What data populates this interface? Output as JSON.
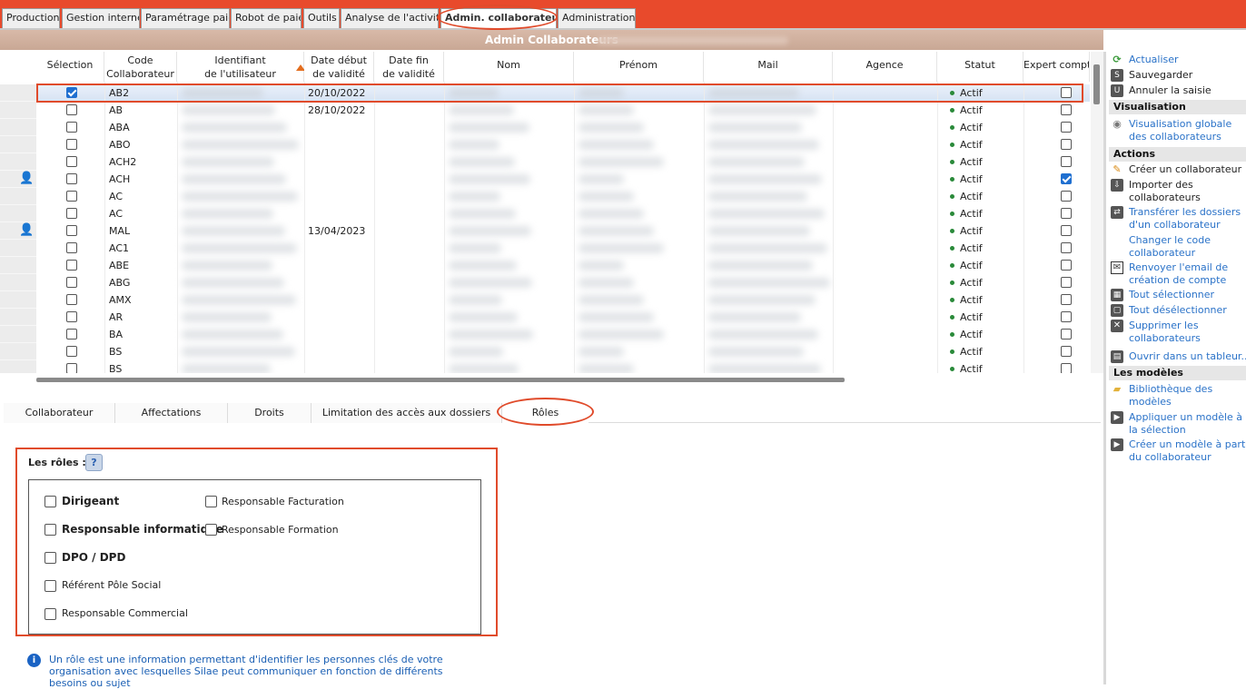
{
  "tabs": [
    "Production",
    "Gestion interne",
    "Paramétrage paie",
    "Robot de paie",
    "Outils",
    "Analyse de l'activité",
    "Admin. collaborateurs",
    "Administration"
  ],
  "page_title": "Admin Collaborateurs",
  "grid": {
    "headers": {
      "selection": "Sélection",
      "code_1": "Code",
      "code_2": "Collaborateur",
      "ident_1": "Identifiant",
      "ident_2": "de l'utilisateur",
      "debut_1": "Date début",
      "debut_2": "de validité",
      "fin_1": "Date fin",
      "fin_2": "de validité",
      "nom": "Nom",
      "prenom": "Prénom",
      "mail": "Mail",
      "agence": "Agence",
      "statut": "Statut",
      "expert": "Expert compt"
    },
    "rows": [
      {
        "code": "AB2",
        "debut": "20/10/2022",
        "statut": "Actif",
        "selected": true,
        "expert": false,
        "icon": false
      },
      {
        "code": "AB",
        "debut": "28/10/2022",
        "statut": "Actif",
        "selected": false,
        "expert": false,
        "icon": false
      },
      {
        "code": "ABA",
        "debut": "",
        "statut": "Actif",
        "selected": false,
        "expert": false,
        "icon": false
      },
      {
        "code": "ABO",
        "debut": "",
        "statut": "Actif",
        "selected": false,
        "expert": false,
        "icon": false
      },
      {
        "code": "ACH2",
        "debut": "",
        "statut": "Actif",
        "selected": false,
        "expert": false,
        "icon": false
      },
      {
        "code": "ACH",
        "debut": "",
        "statut": "Actif",
        "selected": false,
        "expert": true,
        "icon": true
      },
      {
        "code": "AC",
        "debut": "",
        "statut": "Actif",
        "selected": false,
        "expert": false,
        "icon": false
      },
      {
        "code": "AC",
        "debut": "",
        "statut": "Actif",
        "selected": false,
        "expert": false,
        "icon": false
      },
      {
        "code": "MAL",
        "debut": "13/04/2023",
        "statut": "Actif",
        "selected": false,
        "expert": false,
        "icon": true
      },
      {
        "code": "AC1",
        "debut": "",
        "statut": "Actif",
        "selected": false,
        "expert": false,
        "icon": false
      },
      {
        "code": "ABE",
        "debut": "",
        "statut": "Actif",
        "selected": false,
        "expert": false,
        "icon": false
      },
      {
        "code": "ABG",
        "debut": "",
        "statut": "Actif",
        "selected": false,
        "expert": false,
        "icon": false
      },
      {
        "code": "AMX",
        "debut": "",
        "statut": "Actif",
        "selected": false,
        "expert": false,
        "icon": false
      },
      {
        "code": "AR",
        "debut": "",
        "statut": "Actif",
        "selected": false,
        "expert": false,
        "icon": false
      },
      {
        "code": "BA",
        "debut": "",
        "statut": "Actif",
        "selected": false,
        "expert": false,
        "icon": false
      },
      {
        "code": "BS",
        "debut": "",
        "statut": "Actif",
        "selected": false,
        "expert": false,
        "icon": false
      },
      {
        "code": "BS",
        "debut": "",
        "statut": "Actif",
        "selected": false,
        "expert": false,
        "icon": false
      }
    ]
  },
  "subtabs": [
    "Collaborateur",
    "Affectations",
    "Droits",
    "Limitation des accès aux dossiers",
    "Rôles"
  ],
  "roles": {
    "label": "Les rôles :",
    "left": [
      {
        "label": "Dirigeant",
        "bold": true
      },
      {
        "label": "Responsable informatique",
        "bold": true
      },
      {
        "label": "DPO / DPD",
        "bold": true
      },
      {
        "label": "Référent Pôle Social",
        "bold": false
      },
      {
        "label": "Responsable Commercial",
        "bold": false
      }
    ],
    "right": [
      {
        "label": "Responsable Facturation"
      },
      {
        "label": "Responsable Formation"
      }
    ]
  },
  "info_text": "Un rôle est une information permettant d'identifier les personnes clés de votre organisation avec lesquelles Silae peut communiquer en fonction de différents besoins ou sujet",
  "right_panel": {
    "actualiser": "Actualiser",
    "sauvegarder": "Sauvegarder",
    "annuler": "Annuler la saisie",
    "sec_visualisation": "Visualisation",
    "visu_globale_1": "Visualisation globale",
    "visu_globale_2": "des collaborateurs",
    "sec_actions": "Actions",
    "creer": "Créer un collaborateur",
    "importer_1": "Importer des",
    "importer_2": "collaborateurs",
    "transferer_1": "Transférer les dossiers",
    "transferer_2": "d'un collaborateur",
    "changer_1": "Changer le code",
    "changer_2": "collaborateur",
    "renvoyer_1": "Renvoyer l'email de",
    "renvoyer_2": "création de compte",
    "tout_sel": "Tout sélectionner",
    "tout_desel": "Tout désélectionner",
    "supprimer_1": "Supprimer les",
    "supprimer_2": "collaborateurs",
    "ouvrir": "Ouvrir dans un tableur...",
    "sec_modeles": "Les modèles",
    "biblio_1": "Bibliothèque des",
    "biblio_2": "modèles",
    "appliquer_1": "Appliquer un modèle à",
    "appliquer_2": "la sélection",
    "creer_modele_1": "Créer un modèle à partir",
    "creer_modele_2": "du collaborateur"
  },
  "colors": {
    "accent": "#e84a2c",
    "link": "#2a72c8",
    "checked": "#1f6fd0",
    "status_dot": "#2a8a3a"
  }
}
